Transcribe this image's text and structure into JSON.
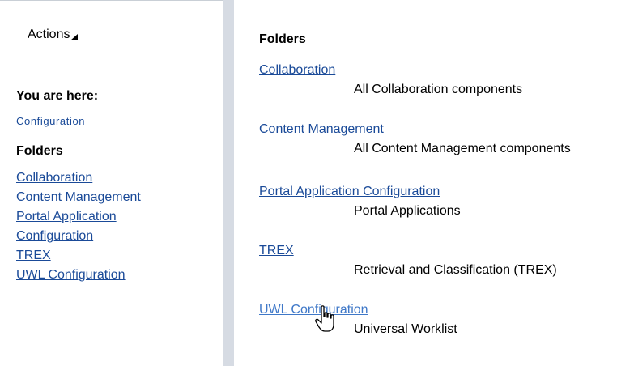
{
  "sidebar": {
    "actions_label": "Actions",
    "you_are_here_label": "You are here:",
    "breadcrumb": "Configuration",
    "folders_heading": "Folders",
    "links": [
      "Collaboration",
      "Content Management",
      "Portal Application Configuration",
      "TREX",
      "UWL Configuration"
    ]
  },
  "main": {
    "folders_heading": "Folders",
    "entries": [
      {
        "link": "Collaboration",
        "description": "All Collaboration components"
      },
      {
        "link": "Content Management",
        "description": "All Content Management components"
      },
      {
        "link": "Portal Application Configuration",
        "description": "Portal Applications"
      },
      {
        "link": "TREX",
        "description": "Retrieval and Classification (TREX)"
      },
      {
        "link": "UWL Configuration",
        "description": "Universal Worklist"
      }
    ]
  },
  "icons": {
    "actions_menu": "triangle-down-icon",
    "cursor": "hand-pointer-cursor-icon"
  },
  "colors": {
    "link": "#1a4a98",
    "hover_link": "#3f78c8",
    "divider": "#d6dbe3"
  }
}
